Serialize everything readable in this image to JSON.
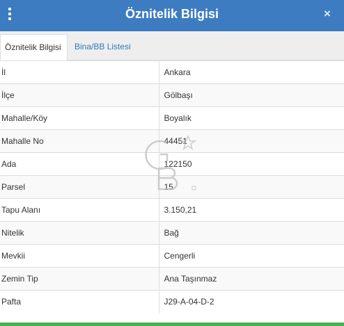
{
  "header": {
    "title": "Öznitelik Bilgisi",
    "close_symbol": "×",
    "menu_icon": "vertical-dots-icon",
    "close_icon": "close-icon",
    "background_color": "#3d7cc0"
  },
  "tabs": [
    {
      "label": "Öznitelik Bilgisi",
      "active": true
    },
    {
      "label": "Bina/BB Listesi",
      "active": false
    }
  ],
  "attributes": [
    {
      "key": "İl",
      "value": "Ankara"
    },
    {
      "key": "İlçe",
      "value": "Gölbaşı"
    },
    {
      "key": "Mahalle/Köy",
      "value": "Boyalık"
    },
    {
      "key": "Mahalle No",
      "value": "44451"
    },
    {
      "key": "Ada",
      "value": "122150"
    },
    {
      "key": "Parsel",
      "value": "15"
    },
    {
      "key": "Tapu Alanı",
      "value": "3.150,21"
    },
    {
      "key": "Nitelik",
      "value": "Bağ"
    },
    {
      "key": "Mevkii",
      "value": "Cengerli"
    },
    {
      "key": "Zemin Tip",
      "value": "Ana Taşınmaz"
    },
    {
      "key": "Pafta",
      "value": "J29-A-04-D-2"
    }
  ],
  "colors": {
    "link": "#337ab7",
    "bottom_bar": "#4caf50"
  }
}
